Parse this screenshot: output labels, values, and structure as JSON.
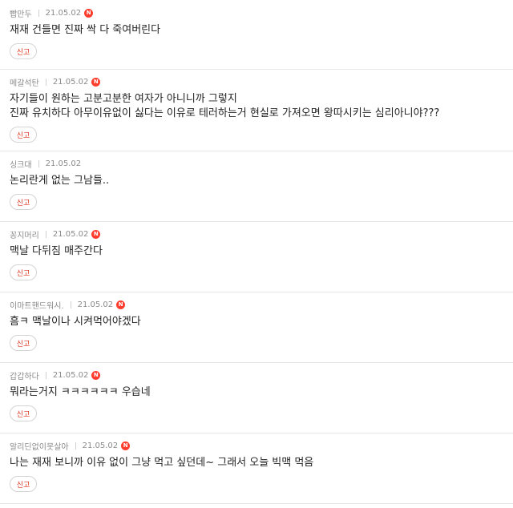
{
  "report_label": "신고",
  "new_badge": "N",
  "comments": [
    {
      "nick": "빱만두",
      "date": "21.05.02",
      "lines": [
        "재재 건들면 진짜 싹 다 죽여버린다"
      ]
    },
    {
      "nick": "메갈석탄",
      "date": "21.05.02",
      "lines": [
        "자기들이 원하는 고분고분한 여자가 아니니까 그렇지",
        "진짜 유치하다 아무이유없이 싫다는 이유로 테러하는거 현실로 가져오면 왕따시키는 심리아니야???"
      ]
    },
    {
      "nick": "싱크대",
      "date": "21.05.02",
      "lines": [
        "논리란게 없는 그남들.."
      ]
    },
    {
      "nick": "꽁지머리",
      "date": "21.05.02",
      "lines": [
        "맥날 다뒤짐 매주간다"
      ]
    },
    {
      "nick": "이마트핸드워시.",
      "date": "21.05.02",
      "lines": [
        "흠ㅋ 맥날이나 시켜먹어야겠다"
      ]
    },
    {
      "nick": "갑갑하다",
      "date": "21.05.02",
      "lines": [
        "뭐라는거지 ㅋㅋㅋㅋㅋㅋ 우습네"
      ]
    },
    {
      "nick": "알리딘없이못살아",
      "date": "21.05.02",
      "lines": [
        "나는 재재 보니까 이유 없이 그냥 먹고 싶던데~ 그래서 오늘 빅맥 먹음"
      ]
    }
  ]
}
